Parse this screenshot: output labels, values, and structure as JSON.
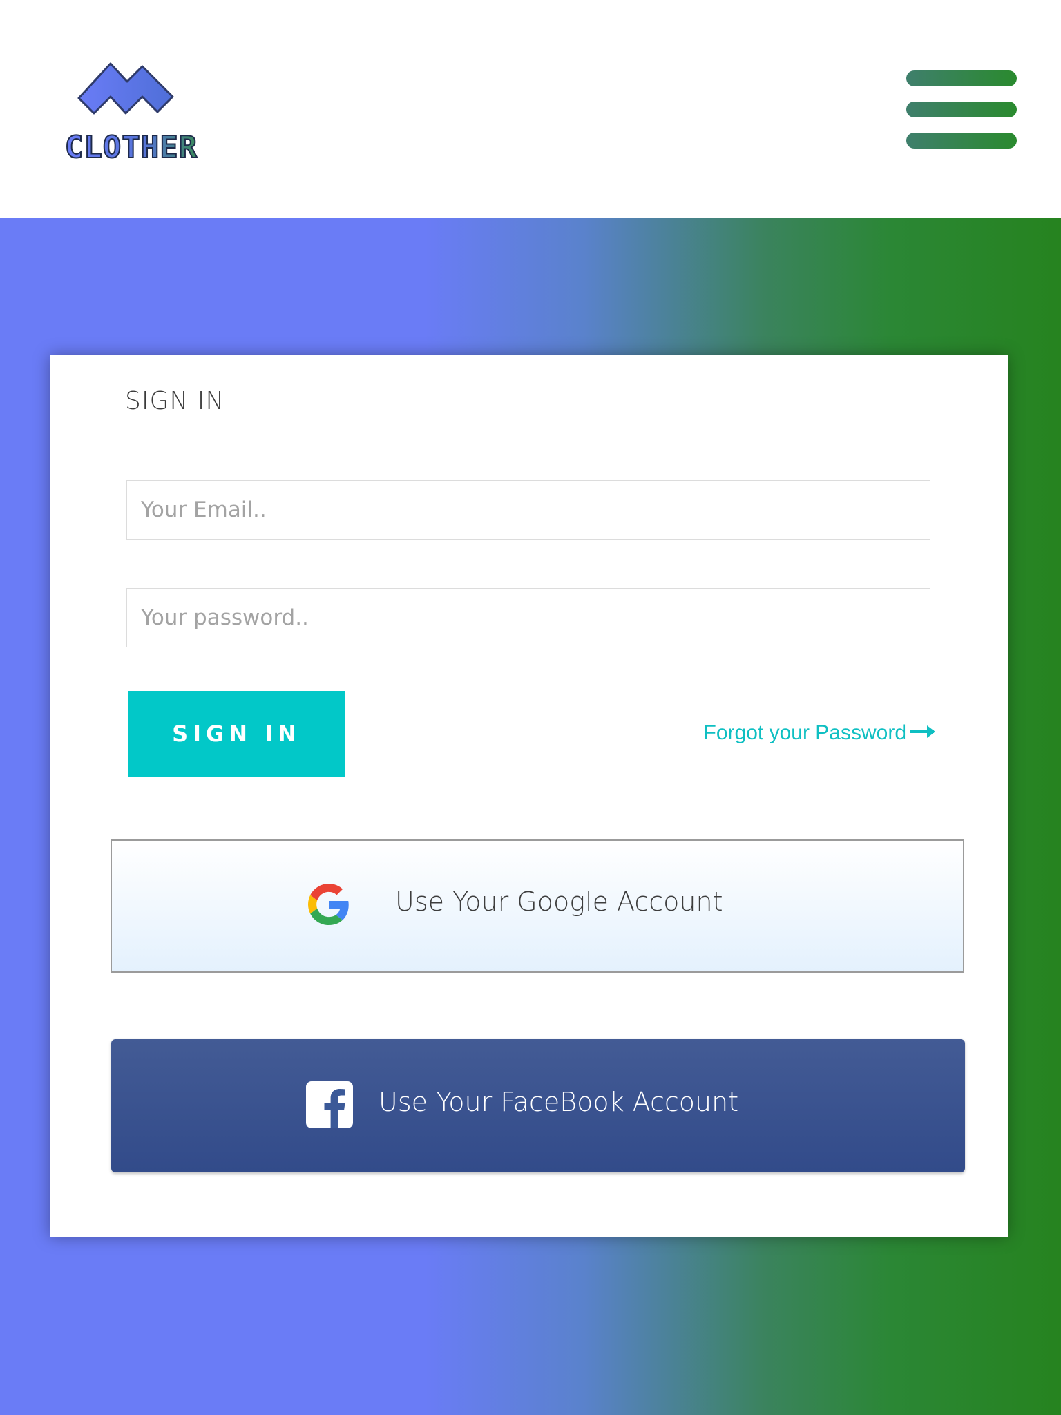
{
  "header": {
    "logo_text": "CLOTHER",
    "menu_icon": "hamburger-menu-icon"
  },
  "signin": {
    "title": "SIGN IN",
    "email_placeholder": "Your Email..",
    "password_placeholder": "Your password..",
    "button_label": "SIGN IN",
    "forgot_label": "Forgot your Password",
    "forgot_icon": "arrow-right-icon"
  },
  "social": {
    "google_label": "Use Your Google Account",
    "google_icon": "google-icon",
    "facebook_label": "Use Your FaceBook Account",
    "facebook_icon": "facebook-icon"
  },
  "colors": {
    "accent": "#02c8c8",
    "gradient_left": "#6a7cf6",
    "gradient_right": "#26831f",
    "facebook": "#3b5998"
  }
}
